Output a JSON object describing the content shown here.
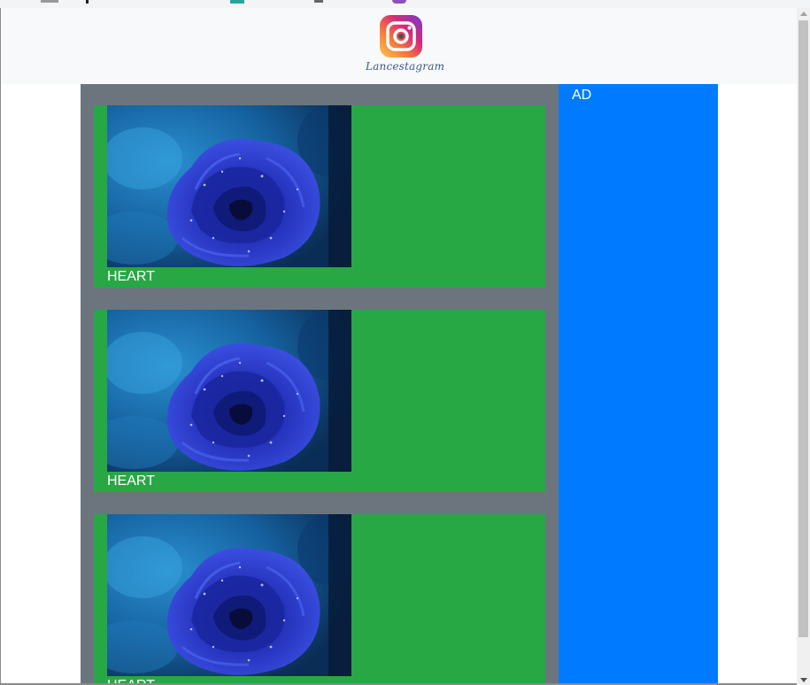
{
  "header": {
    "logo_text": "Lancestagram",
    "logo_icon": "instagram-logo-icon"
  },
  "feed": {
    "posts": [
      {
        "image_icon": "blue-rose-image",
        "caption": "HEART"
      },
      {
        "image_icon": "blue-rose-image",
        "caption": "HEART"
      },
      {
        "image_icon": "blue-rose-image",
        "caption": "HEART"
      }
    ]
  },
  "ad": {
    "label": "AD"
  },
  "colors": {
    "header_bg": "#f8f9fa",
    "feed_bg": "#6c757d",
    "post_bg": "#28a745",
    "ad_bg": "#007bff",
    "text_light": "#ffffff"
  }
}
